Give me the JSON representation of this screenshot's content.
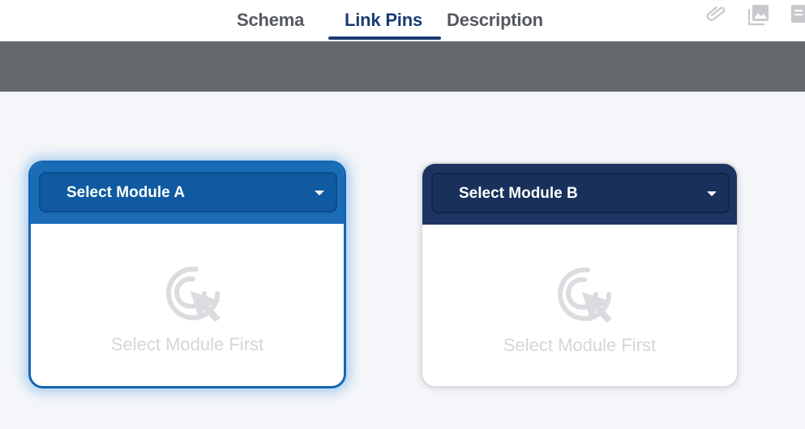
{
  "tabs": [
    {
      "label": "Schema",
      "active": false
    },
    {
      "label": "Link Pins",
      "active": true
    },
    {
      "label": "Description",
      "active": false
    }
  ],
  "toolbar_icons": [
    "paperclip-icon",
    "image-icon",
    "document-icon"
  ],
  "module_a": {
    "select_label": "Select Module A",
    "empty_text": "Select Module First",
    "icon": "click-cursor-icon"
  },
  "module_b": {
    "select_label": "Select Module B",
    "empty_text": "Select Module First",
    "icon": "click-cursor-icon"
  },
  "colors": {
    "active_tab": "#1b3b73",
    "module_a_header": "#1a6cb4",
    "module_b_header": "#1d3461"
  }
}
